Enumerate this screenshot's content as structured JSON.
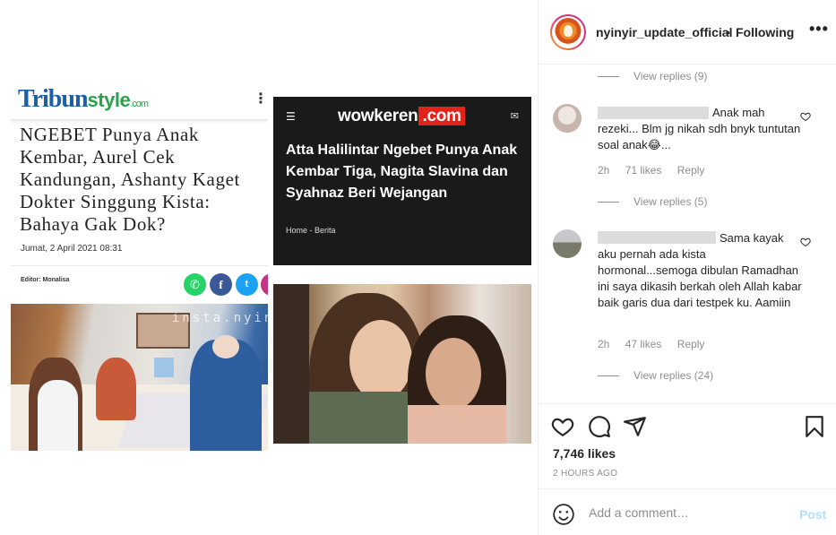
{
  "post": {
    "tribun": {
      "logo_main": "Tribun",
      "logo_style": "style",
      "logo_com": ".com",
      "headline": "NGEBET Punya Anak Kembar, Aurel Cek Kandungan, Ashanty Kaget Dokter Singgung Kista: Bahaya Gak Dok?",
      "date": "Jumat, 2 April 2021 08:31",
      "editor": "Editor: Monalisa",
      "watermark": "insta.nyinyir"
    },
    "wowkeren": {
      "logo": "wowkeren",
      "logo_tld": ".com",
      "headline": "Atta Halilintar Ngebet Punya Anak Kembar Tiga, Nagita Slavina dan Syahnaz Beri Wejangan",
      "breadcrumb": "Home - Berita"
    }
  },
  "header": {
    "username": "nyinyir_update_official",
    "separator": "•",
    "follow_status": "Following",
    "more": "•••"
  },
  "comments": {
    "top_view_replies": "View replies (9)",
    "items": [
      {
        "text": "Anak mah rezeki... Blm jg nikah sdh bnyk tuntutan soal anak😂...",
        "time": "2h",
        "likes": "71 likes",
        "reply": "Reply",
        "view_replies": "View replies (5)"
      },
      {
        "text": "Sama kayak aku pernah ada kista hormonal...semoga dibulan Ramadhan ini saya dikasih berkah oleh Allah kabar baik garis dua dari testpek ku. Aamiin",
        "time": "2h",
        "likes": "47 likes",
        "reply": "Reply",
        "view_replies": "View replies (24)"
      }
    ]
  },
  "actions": {
    "icons": [
      "heart-icon",
      "comment-icon",
      "share-icon",
      "bookmark-icon"
    ],
    "likes": "7,746 likes",
    "time_ago": "2 HOURS AGO"
  },
  "add_comment": {
    "placeholder": "Add a comment…",
    "post_label": "Post"
  },
  "colors": {
    "accent": "#0095f6",
    "post_disabled": "#b2dffc",
    "tribun_blue": "#1b5fa8",
    "tribun_green": "#2aa24a",
    "wowkeren_red": "#e2231a"
  }
}
